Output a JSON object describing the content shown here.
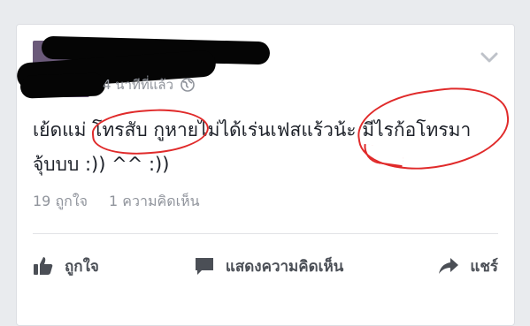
{
  "post": {
    "time_ago": "4 นาทีที่แล้ว",
    "text_line1": "เย้ดแม่ โทรสับ กูหายไม่ได้เร่นเฟสแร้วน้ะ  มีไรก้อโทรมา",
    "text_line2": "จุ้บบบ  :)) ^^ :))",
    "likes": "19 ถูกใจ",
    "comments": "1 ความคิดเห็น"
  },
  "actions": {
    "like_label": "ถูกใจ",
    "comment_label": "แสดงความคิดเห็น",
    "share_label": "แชร์"
  },
  "colors": {
    "text": "#1d2129",
    "muted": "#90949c",
    "annotation_red": "#e02a2a",
    "background": "#e9ebee"
  },
  "icons": [
    "globe-icon",
    "chevron-down-icon",
    "like-icon",
    "comment-icon",
    "share-icon"
  ]
}
